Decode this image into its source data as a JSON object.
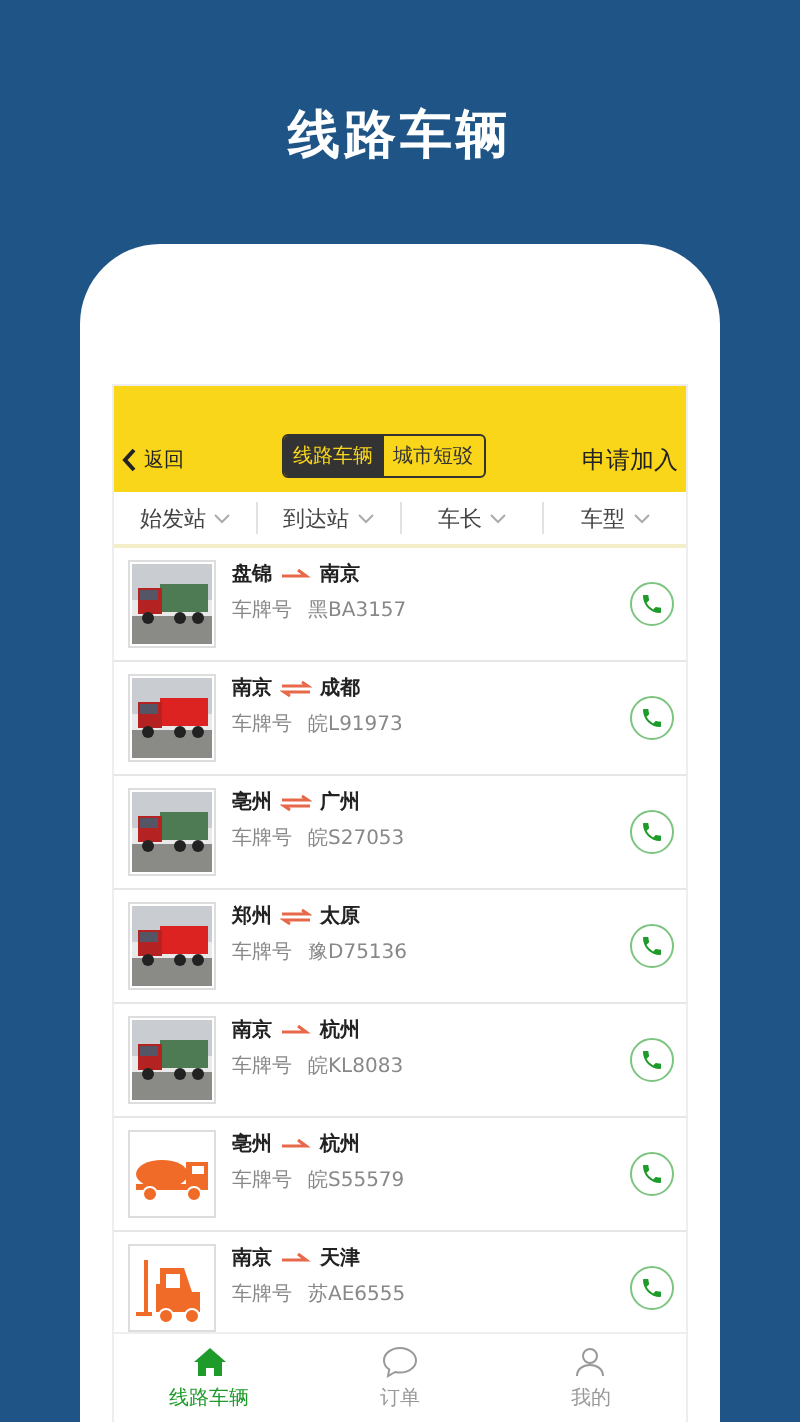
{
  "headline": "线路车辆",
  "header": {
    "back": "返回",
    "tabs": [
      {
        "label": "线路车辆",
        "selected": true
      },
      {
        "label": "城市短驳",
        "selected": false
      }
    ],
    "action": "申请加入"
  },
  "filters": [
    "始发站",
    "到达站",
    "车长",
    "车型"
  ],
  "vehicles": [
    {
      "from": "盘锦",
      "to": "南京",
      "round_trip": false,
      "plate_label": "车牌号",
      "plate": "黑BA3157"
    },
    {
      "from": "南京",
      "to": "成都",
      "round_trip": true,
      "plate_label": "车牌号",
      "plate": "皖L91973"
    },
    {
      "from": "亳州",
      "to": "广州",
      "round_trip": true,
      "plate_label": "车牌号",
      "plate": "皖S27053"
    },
    {
      "from": "郑州",
      "to": "太原",
      "round_trip": true,
      "plate_label": "车牌号",
      "plate": "豫D75136"
    },
    {
      "from": "南京",
      "to": "杭州",
      "round_trip": false,
      "plate_label": "车牌号",
      "plate": "皖KL8083"
    },
    {
      "thumbnail": {
        "kind": "tanker"
      },
      "from": "亳州",
      "to": "杭州",
      "round_trip": false,
      "plate_label": "车牌号",
      "plate": "皖S55579"
    },
    {
      "thumbnail": {
        "kind": "forklift"
      },
      "from": "南京",
      "to": "天津",
      "round_trip": false,
      "plate_label": "车牌号",
      "plate": "苏AE6555"
    }
  ],
  "nav": [
    {
      "label": "线路车辆",
      "kind": "home",
      "selected": true
    },
    {
      "label": "订单",
      "kind": "chat",
      "selected": false
    },
    {
      "label": "我的",
      "kind": "person",
      "selected": false
    }
  ]
}
